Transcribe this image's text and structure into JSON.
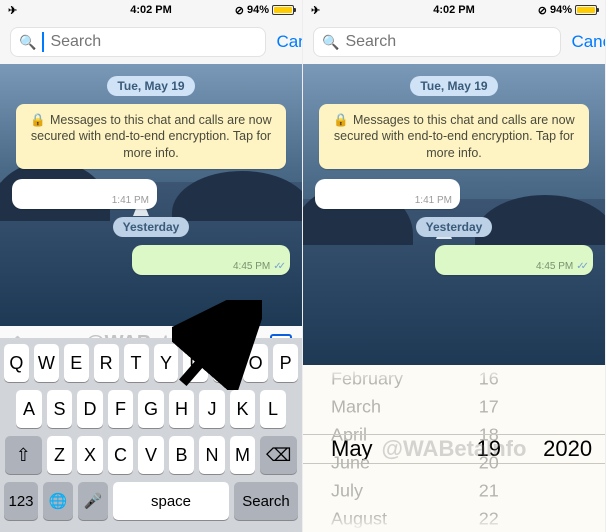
{
  "status": {
    "time": "4:02 PM",
    "battery_pct": "94%"
  },
  "search": {
    "placeholder": "Search",
    "cancel": "Cancel"
  },
  "chat": {
    "date1": "Tue, May 19",
    "encryption_notice": "Messages to this chat and calls are now secured with end-to-end encryption. Tap for more info.",
    "incoming_time": "1:41 PM",
    "date2": "Yesterday",
    "outgoing_time": "4:45 PM"
  },
  "watermark": "@WABetaInfo",
  "keyboard": {
    "row1": [
      "Q",
      "W",
      "E",
      "R",
      "T",
      "Y",
      "U",
      "I",
      "O",
      "P"
    ],
    "row2": [
      "A",
      "S",
      "D",
      "F",
      "G",
      "H",
      "J",
      "K",
      "L"
    ],
    "shift": "⇧",
    "row3": [
      "Z",
      "X",
      "C",
      "V",
      "B",
      "N",
      "M"
    ],
    "backspace": "⌫",
    "num": "123",
    "globe": "🌐",
    "mic": "🎤",
    "space": "space",
    "search": "Search"
  },
  "picker": {
    "months_above": [
      "February",
      "March",
      "April"
    ],
    "month_selected": "May",
    "months_below": [
      "June",
      "July",
      "August"
    ],
    "days_above": [
      "16",
      "17",
      "18"
    ],
    "day_selected": "19",
    "days_below": [
      "20",
      "21",
      "22"
    ],
    "year_selected": "2020"
  }
}
